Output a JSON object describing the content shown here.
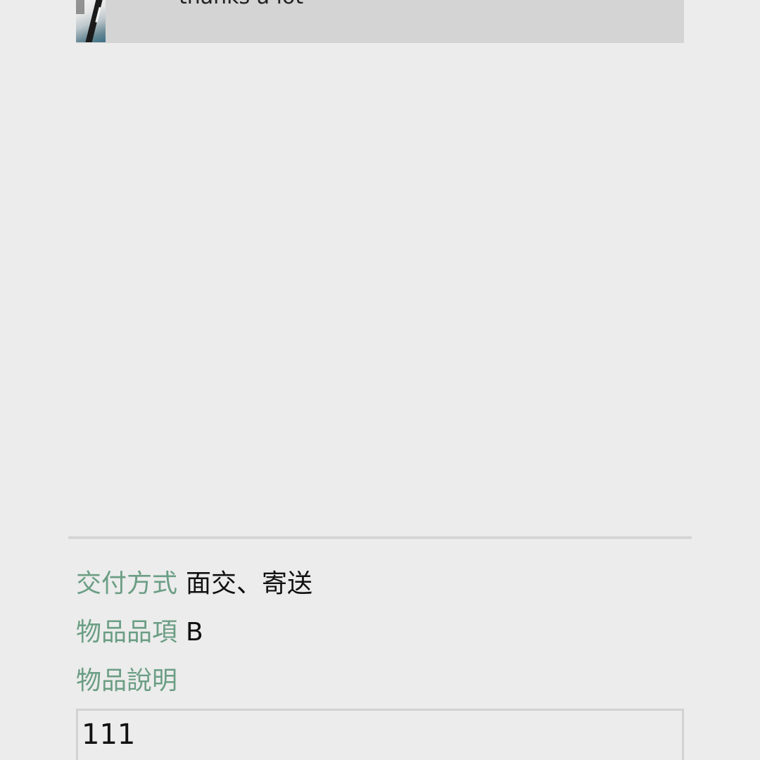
{
  "message": {
    "text": "thanks a lot",
    "thumbnail_icon": "pen-photo-thumbnail"
  },
  "details": {
    "delivery_label": "交付方式",
    "delivery_value": "面交、寄送",
    "category_label": "物品品項",
    "category_value": "B",
    "description_label": "物品說明",
    "description_value": "111"
  },
  "colors": {
    "background": "#ececec",
    "label": "#6b9e84",
    "card": "#d4d4d4"
  }
}
